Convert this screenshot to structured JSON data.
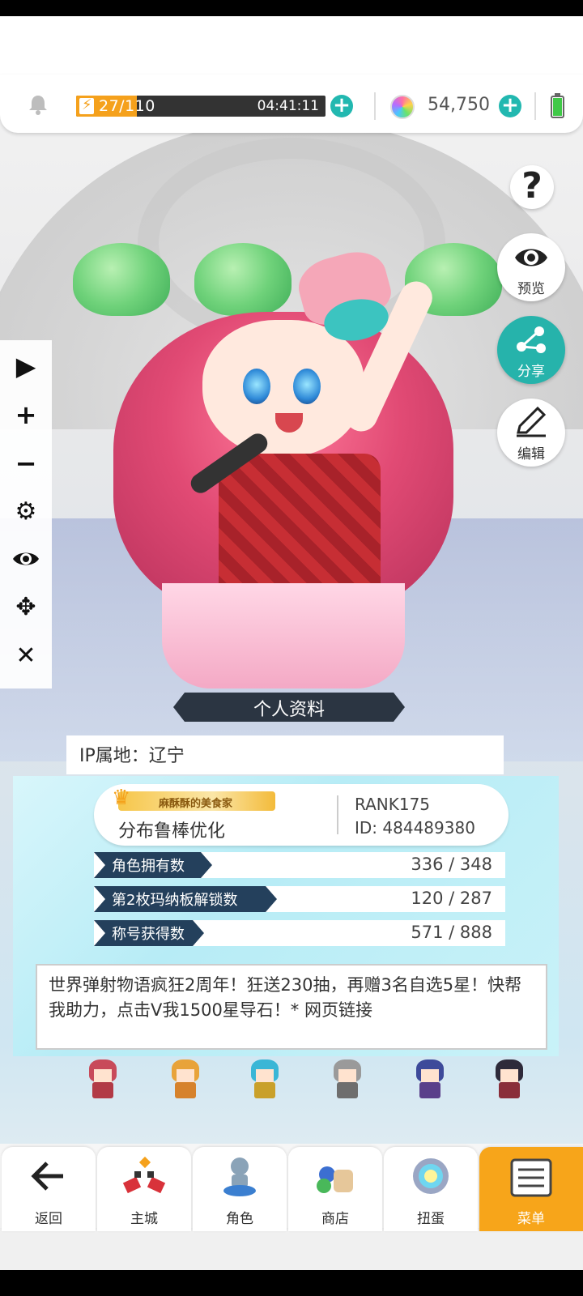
{
  "status_bar": {
    "stamina_current": "27",
    "stamina_text": "27/110",
    "stamina_timer": "04:41:11",
    "stamina_fraction": 0.245,
    "gems": "54,750",
    "battery_level": 0.9
  },
  "side_buttons": {
    "help": "?",
    "preview": "预览",
    "share": "分享",
    "edit": "编辑"
  },
  "left_tools": [
    "play",
    "plus",
    "minus",
    "settings",
    "eye",
    "move",
    "close"
  ],
  "profile": {
    "section_title": "个人资料",
    "ip_location": "IP属地：辽宁",
    "badge_title": "麻酥酥的美食家",
    "nickname": "分布鲁棒优化",
    "rank": "RANK175",
    "id": "ID: 484489380",
    "stats": [
      {
        "label": "角色拥有数",
        "value": "336 / 348"
      },
      {
        "label": "第2枚玛纳板解锁数",
        "value": "120 / 287"
      },
      {
        "label": "称号获得数",
        "value": "571 / 888"
      }
    ],
    "message": "世界弹射物语疯狂2周年！狂送230抽，再赠3名自选5星！快帮我助力，点击V我1500星导石！* 网页链接"
  },
  "bottom_nav": [
    {
      "label": "返回",
      "icon": "back-arrow-icon",
      "active": false
    },
    {
      "label": "主城",
      "icon": "castle-icon",
      "active": false
    },
    {
      "label": "角色",
      "icon": "character-icon",
      "active": false
    },
    {
      "label": "商店",
      "icon": "shop-bag-icon",
      "active": false
    },
    {
      "label": "扭蛋",
      "icon": "gacha-icon",
      "active": false
    },
    {
      "label": "菜单",
      "icon": "menu-list-icon",
      "active": true
    }
  ],
  "colors": {
    "accent_teal": "#26b3ab",
    "accent_orange": "#f7a51a",
    "panel_dark": "#24405c"
  }
}
